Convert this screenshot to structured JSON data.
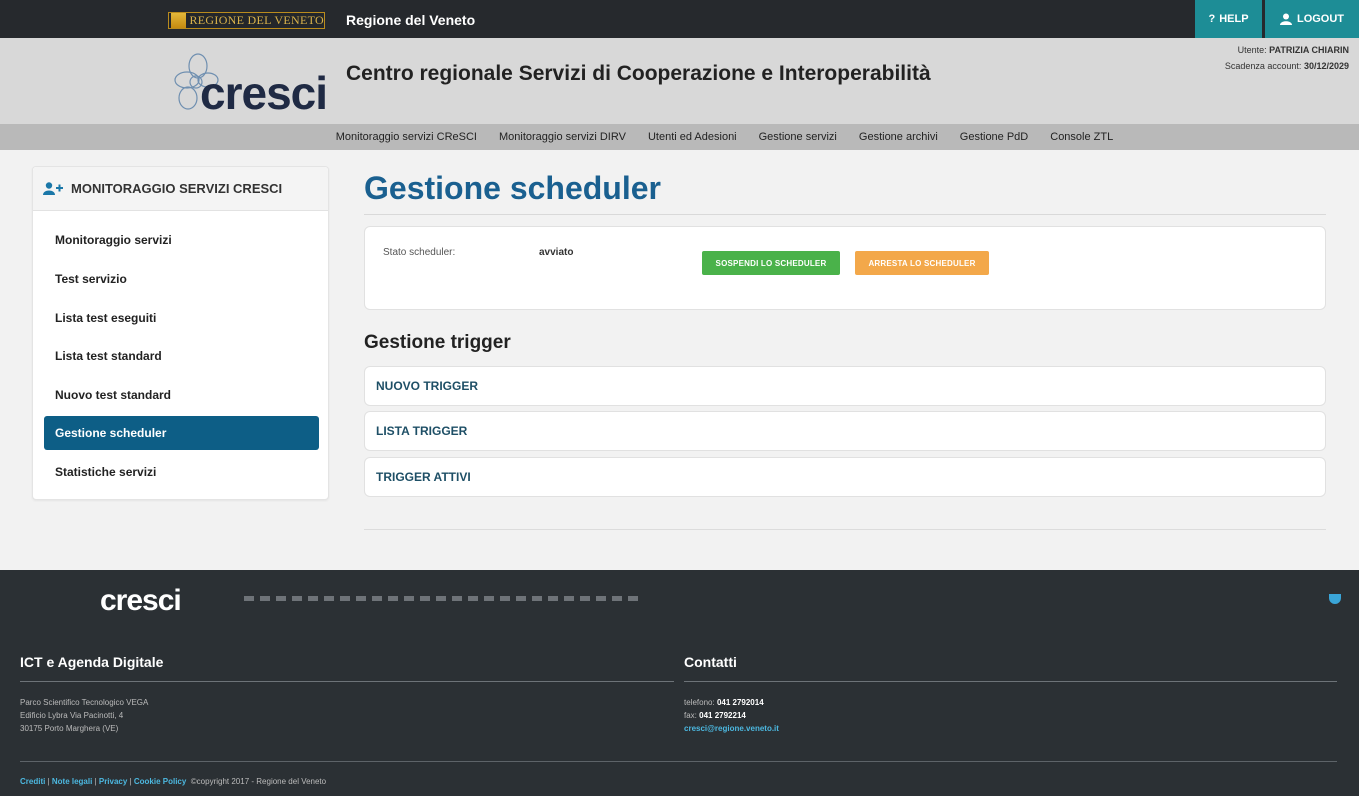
{
  "topbar": {
    "regione_logo_text": "REGIONE DEL VENETO",
    "regione_name": "Regione del Veneto",
    "help_label": "HELP",
    "logout_label": "LOGOUT"
  },
  "header": {
    "logo_text": "cresci",
    "title": "Centro regionale Servizi di Cooperazione e Interoperabilità",
    "user_label": "Utente:",
    "user_name": "PATRIZIA CHIARIN",
    "expiry_label": "Scadenza account:",
    "expiry_date": "30/12/2029"
  },
  "nav": {
    "items": [
      "Monitoraggio servizi CReSCI",
      "Monitoraggio servizi DIRV",
      "Utenti ed Adesioni",
      "Gestione servizi",
      "Gestione archivi",
      "Gestione PdD",
      "Console ZTL"
    ]
  },
  "sidebar": {
    "title": "MONITORAGGIO SERVIZI CRESCI",
    "items": [
      "Monitoraggio servizi",
      "Test servizio",
      "Lista test eseguiti",
      "Lista test standard",
      "Nuovo test standard",
      "Gestione scheduler",
      "Statistiche servizi"
    ],
    "active_index": 5
  },
  "main": {
    "title": "Gestione scheduler",
    "scheduler": {
      "state_label": "Stato scheduler:",
      "state_value": "avviato",
      "suspend_label": "SOSPENDI LO SCHEDULER",
      "stop_label": "ARRESTA LO SCHEDULER"
    },
    "trigger_title": "Gestione trigger",
    "triggers": [
      "NUOVO TRIGGER",
      "LISTA TRIGGER",
      "TRIGGER ATTIVI"
    ]
  },
  "footer": {
    "logo_text": "cresci",
    "left_title": "ICT e Agenda Digitale",
    "address": [
      "Parco Scientifico Tecnologico VEGA",
      "Edificio Lybra Via Pacinotti, 4",
      "30175 Porto Marghera (VE)"
    ],
    "right_title": "Contatti",
    "phone_label": "telefono:",
    "phone": "041 2792014",
    "fax_label": "fax:",
    "fax": "041 2792214",
    "email": "cresci@regione.veneto.it",
    "links": [
      "Crediti",
      "Note legali",
      "Privacy",
      "Cookie Policy"
    ],
    "copyright": "©copyright 2017 - Regione del Veneto"
  },
  "colors": {
    "accent_blue": "#1a6090",
    "active_item": "#0d5e86",
    "suspend_green": "#4ab24a",
    "stop_orange": "#f3a84a",
    "teal_button": "#1d8d96"
  }
}
